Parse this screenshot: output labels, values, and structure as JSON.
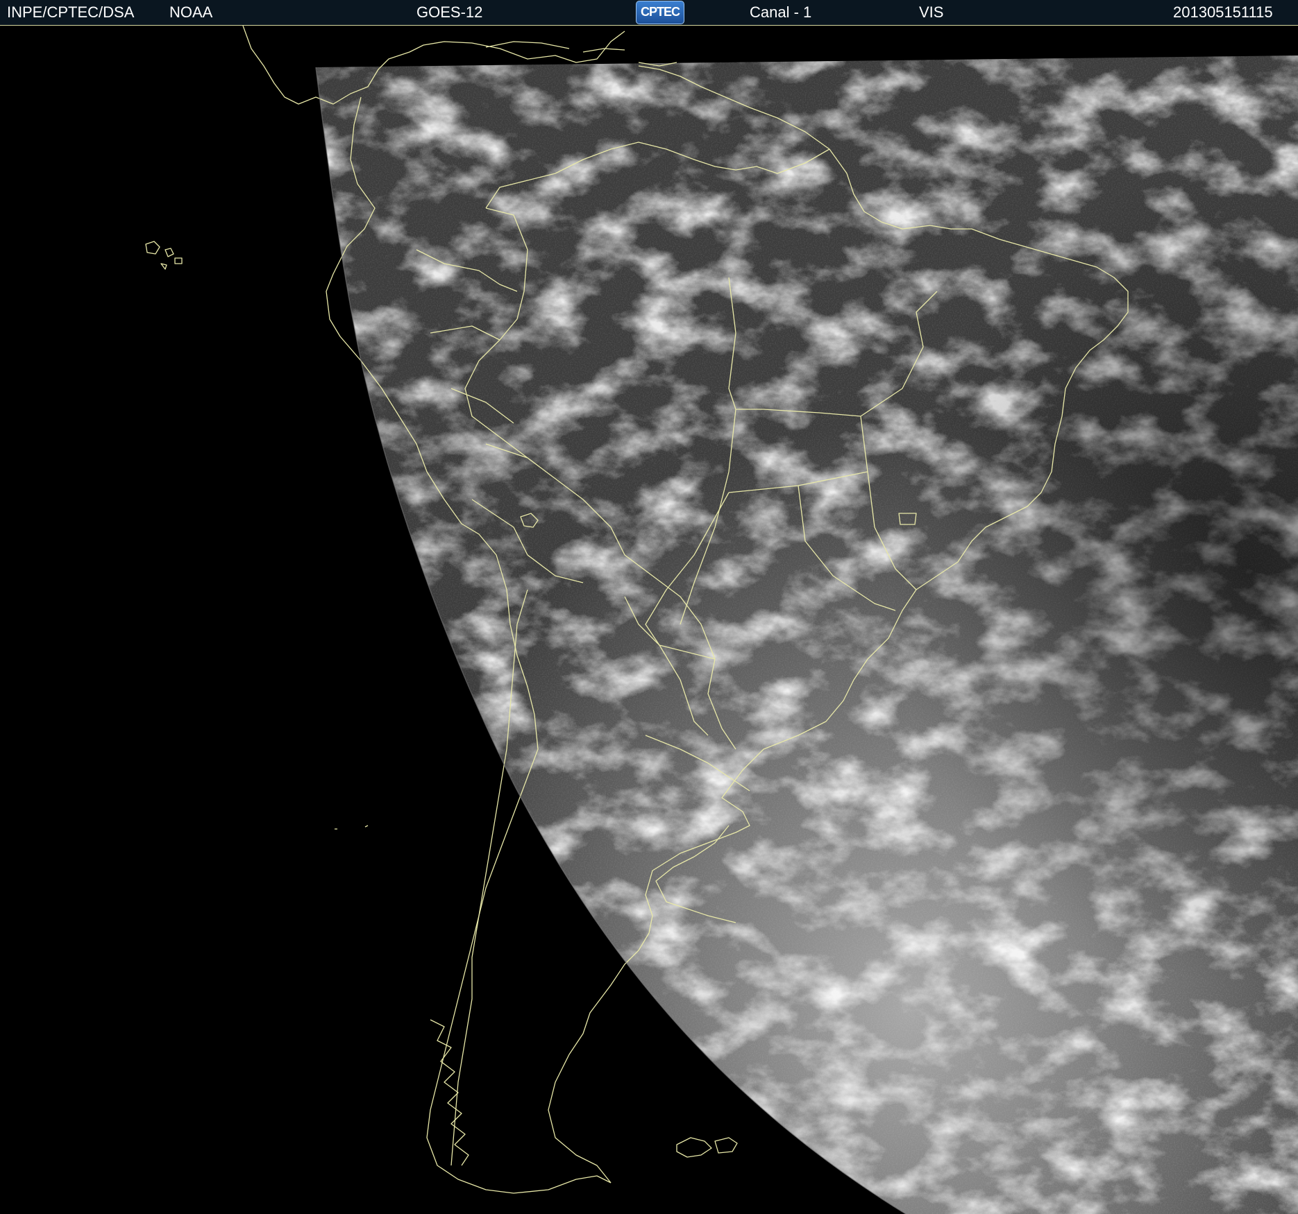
{
  "header": {
    "institution": "INPE/CPTEC/DSA",
    "agency": "NOAA",
    "satellite": "GOES-12",
    "logo_text": "CPTEC",
    "channel": "Canal - 1",
    "band": "VIS",
    "timestamp": "201305151115"
  },
  "map": {
    "coastline_color": "#e8e8a8",
    "space_color": "#000000",
    "earth_base_color": "#3c3c3c",
    "cloud_color": "#f2f2f2"
  }
}
